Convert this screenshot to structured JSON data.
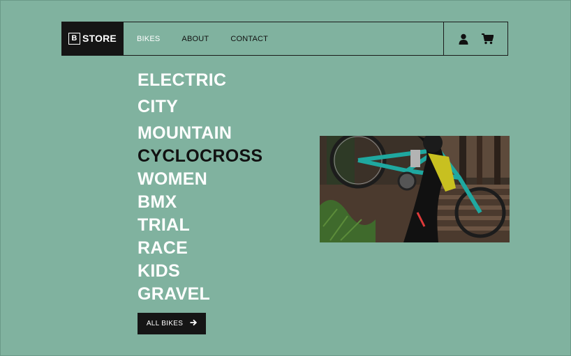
{
  "logo": {
    "mark": "B",
    "text": "STORE"
  },
  "nav": [
    {
      "label": "BIKES",
      "active": true
    },
    {
      "label": "ABOUT",
      "active": false
    },
    {
      "label": "CONTACT",
      "active": false
    }
  ],
  "icons": [
    "user-icon",
    "cart-icon"
  ],
  "categories": [
    {
      "label": "ELECTRIC",
      "active": false
    },
    {
      "label": "CITY",
      "active": false
    },
    {
      "label": "MOUNTAIN",
      "active": false
    },
    {
      "label": "CYCLOCROSS",
      "active": true
    },
    {
      "label": "WOMEN",
      "active": false
    },
    {
      "label": "BMX",
      "active": false
    },
    {
      "label": "TRIAL",
      "active": false
    },
    {
      "label": "RACE",
      "active": false
    },
    {
      "label": "KIDS",
      "active": false
    },
    {
      "label": "GRAVEL",
      "active": false
    }
  ],
  "cta": {
    "label": "ALL BIKES",
    "icon": "arrow-right-icon"
  },
  "colors": {
    "background": "#80b29f",
    "dark": "#151515",
    "accent_text": "#ffffff"
  }
}
